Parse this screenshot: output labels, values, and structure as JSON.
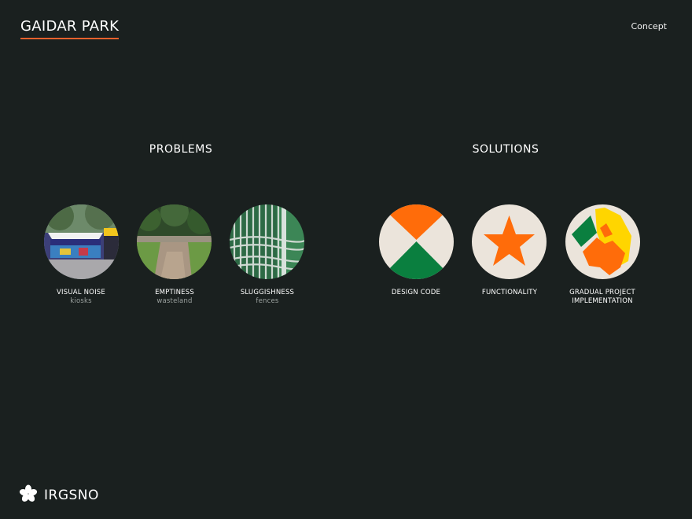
{
  "header": {
    "title": "GAIDAR PARK",
    "nav_concept": "Concept"
  },
  "problems": {
    "title": "PROBLEMS",
    "items": [
      {
        "label": "VISUAL NOISE",
        "sub": "kiosks"
      },
      {
        "label": "EMPTINESS",
        "sub": "wasteland"
      },
      {
        "label": "SLUGGISHNESS",
        "sub": "fences"
      }
    ]
  },
  "solutions": {
    "title": "SOLUTIONS",
    "items": [
      {
        "label": "DESIGN CODE"
      },
      {
        "label": "FUNCTIONALITY"
      },
      {
        "label": "GRADUAL PROJECT IMPLEMENTATION"
      }
    ]
  },
  "footer": {
    "logo_text": "IRGSNO",
    "logo_icon": "asterisk-icon"
  },
  "colors": {
    "background": "#1a201f",
    "accent_orange": "#ff6c0a",
    "accent_green": "#0a7f3f",
    "accent_yellow": "#ffd500",
    "circle_bg": "#ebe4db",
    "underline": "#e8612c"
  }
}
